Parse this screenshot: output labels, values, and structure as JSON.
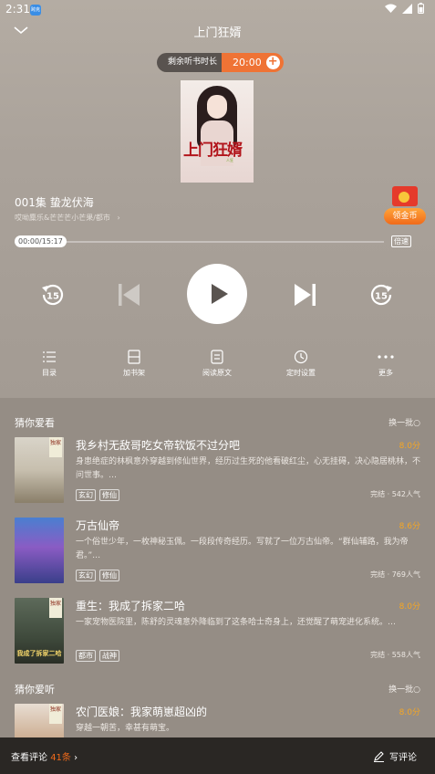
{
  "status": {
    "time": "2:31",
    "app_badge": "跨克"
  },
  "header": {
    "title": "上门狂婿"
  },
  "timer": {
    "label": "剩余听书时长",
    "value": "20:00",
    "plus": "+"
  },
  "cover": {
    "title_art": "上门狂婿",
    "author_badge": "人狂"
  },
  "episode": {
    "title": "001集 蛰龙伏海",
    "credits": "哎呦麋乐&芒芒芒小芒果/都市",
    "arrow": "›"
  },
  "gold_coin": {
    "label": "领金币"
  },
  "progress": {
    "time": "00:00/15:17",
    "fraction": 0.0,
    "speed_label": "倍速"
  },
  "controls": {
    "back_seconds": "15",
    "forward_seconds": "15"
  },
  "menu": [
    {
      "label": "目录"
    },
    {
      "label": "加书架"
    },
    {
      "label": "阅读原文"
    },
    {
      "label": "定时设置"
    },
    {
      "label": "更多"
    }
  ],
  "rec_watch": {
    "heading": "猜你爱看",
    "refresh": "换一批○"
  },
  "books": [
    {
      "name": "我乡村无敌哥吃女帝软饭不过分吧",
      "score": "8.0分",
      "desc": "身患绝症的林枫意外穿越到修仙世界，经历过生死的他看破红尘，心无挂碍，决心隐居桃林，不问世事。…",
      "tags": [
        "玄幻",
        "修仙"
      ],
      "stat": "完结 · 542人气",
      "badge": "独家"
    },
    {
      "name": "万古仙帝",
      "score": "8.6分",
      "desc": "一个俗世少年，一枚神秘玉佩。一段段传奇经历。写就了一位万古仙帝。“群仙辅路，我为帝君。”…",
      "tags": [
        "玄幻",
        "修仙"
      ],
      "stat": "完结 · 769人气",
      "badge": ""
    },
    {
      "name": "重生：我成了拆家二哈",
      "score": "8.0分",
      "desc": "一家宠物医院里，陈舒的灵魂意外降临到了这条哈士奇身上，还觉醒了萌宠进化系统。…",
      "tags": [
        "都市",
        "战神"
      ],
      "stat": "完结 · 558人气",
      "badge": "独家",
      "cover_text": "我成了拆家二哈"
    }
  ],
  "rec_listen": {
    "heading": "猜你爱听",
    "refresh": "换一批○"
  },
  "listen_books": [
    {
      "name": "农门医娘：我家萌崽超凶的",
      "score": "8.0分",
      "desc": "穿越一朝苦，幸甚有萌宝。",
      "badge": "独家"
    }
  ],
  "footer": {
    "comments_label": "查看评论",
    "comments_count": "41条",
    "arrow": "›",
    "write_label": "写评论"
  }
}
